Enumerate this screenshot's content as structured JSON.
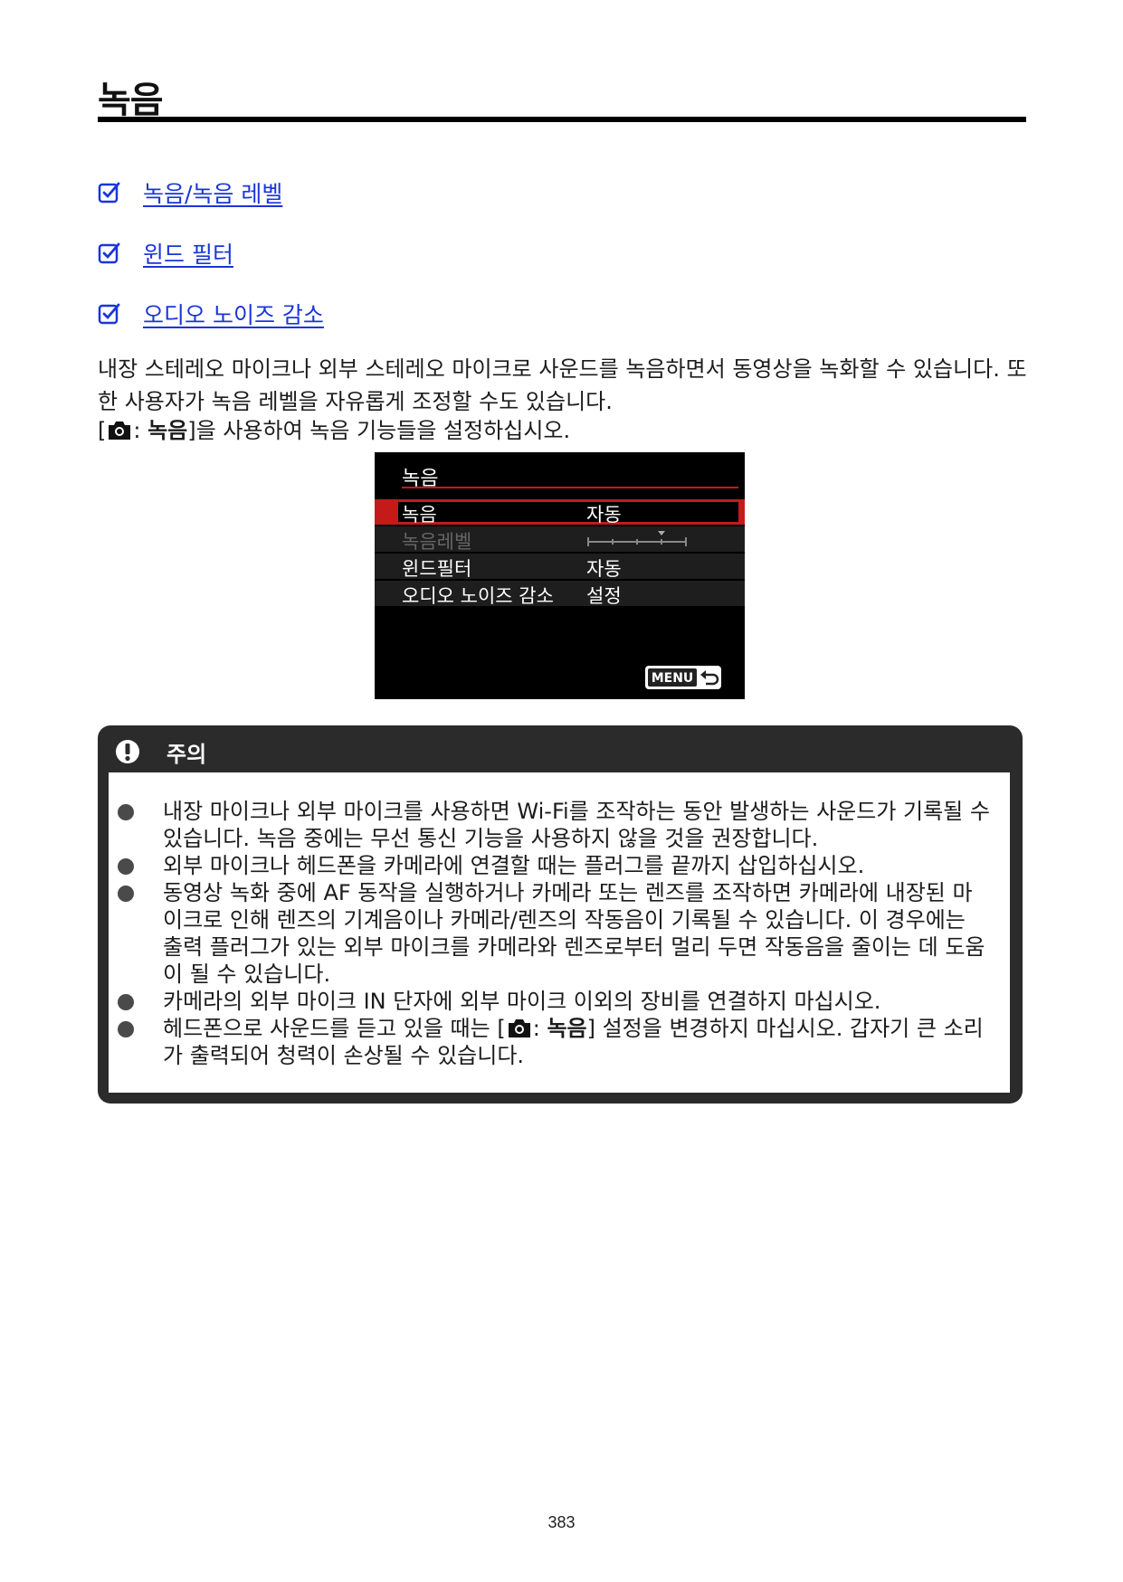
{
  "title": "녹음",
  "links": [
    {
      "label": "녹음/녹음 레벨",
      "icon": "checkbox-edit-icon"
    },
    {
      "label": "윈드 필터",
      "icon": "checkbox-edit-icon"
    },
    {
      "label": "오디오 노이즈 감소",
      "icon": "checkbox-edit-icon"
    }
  ],
  "intro": {
    "line1": "내장 스테레오 마이크나 외부 스테레오 마이크로 사운드를 녹음하면서 동영상을 녹화할 수 있습니다. 또한 사용자가 녹음 레벨을 자유롭게 조정할 수도 있습니다.",
    "line2_open": "[",
    "line2_colon": ": ",
    "line2_bold": "녹음",
    "line2_rest": "]을 사용하여 녹음 기능들을 설정하십시오."
  },
  "camera_menu": {
    "title": "녹음",
    "rows": [
      {
        "label": "녹음",
        "value": "자동"
      },
      {
        "label": "녹음레벨",
        "value": ""
      },
      {
        "label": "윈드필터",
        "value": "자동"
      },
      {
        "label": "오디오 노이즈 감소",
        "value": "설정"
      }
    ],
    "menu_button": "MENU"
  },
  "caution": {
    "title": "주의",
    "icon": "exclamation-icon",
    "items": [
      "내장 마이크나 외부 마이크를 사용하면 Wi-Fi를 조작하는 동안 발생하는 사운드가 기록될 수 있습니다. 녹음 중에는 무선 통신 기능을 사용하지 않을 것을 권장합니다.",
      "외부 마이크나 헤드폰을 카메라에 연결할 때는 플러그를 끝까지 삽입하십시오.",
      "동영상 녹화 중에 AF 동작을 실행하거나 카메라 또는 렌즈를 조작하면 카메라에 내장된 마이크로 인해 렌즈의 기계음이나 카메라/렌즈의 작동음이 기록될 수 있습니다. 이 경우에는 출력 플러그가 있는 외부 마이크를 카메라와 렌즈로부터 멀리 두면 작동음을 줄이는 데 도움이 될 수 있습니다.",
      "카메라의 외부 마이크 IN 단자에 외부 마이크 이외의 장비를 연결하지 마십시오."
    ],
    "last_item": {
      "before": "헤드폰으로 사운드를 듣고 있을 때는 [",
      "colon": ": ",
      "bold": "녹음",
      "after": "] 설정을 변경하지 마십시오. 갑자기 큰 소리가 출력되어 청력이 손상될 수 있습니다."
    }
  },
  "page_number": "383"
}
